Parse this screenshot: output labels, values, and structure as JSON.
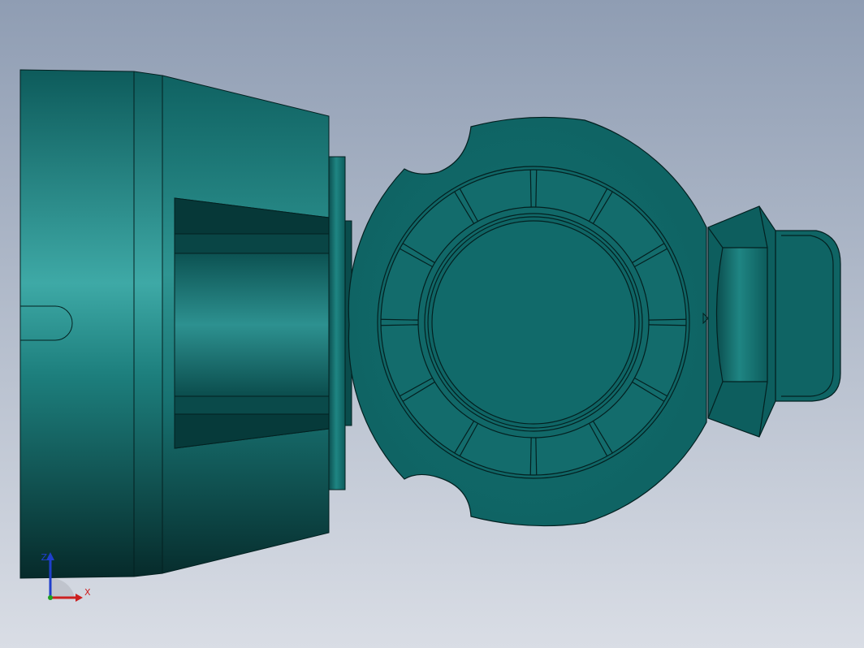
{
  "viewport": {
    "background_top": "#8f9db3",
    "background_bottom": "#d9dde5"
  },
  "model": {
    "body_color": "#136d6d",
    "body_dark": "#0a4444",
    "body_light": "#3ea9a6",
    "edge_color": "#032020"
  },
  "triad": {
    "x_label": "X",
    "z_label": "Z",
    "x_color": "#cc1f1f",
    "z_color": "#1f3fcc",
    "y_color": "#1fa01f"
  }
}
